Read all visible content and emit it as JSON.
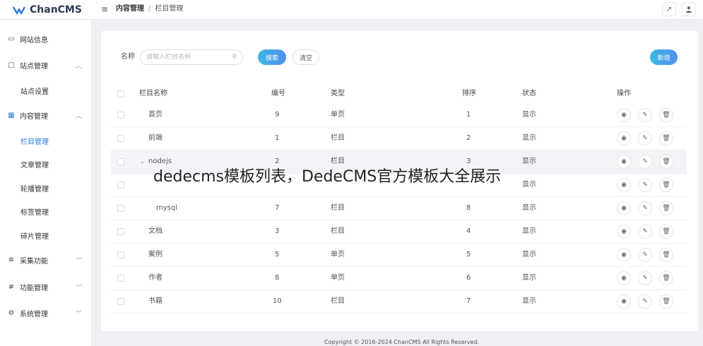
{
  "app": {
    "name": "ChanCMS"
  },
  "header": {
    "breadcrumb": [
      "内容管理",
      "栏目管理"
    ],
    "menu_icon": "menu-icon",
    "external_icon": "external-link-icon",
    "user_icon": "user-icon"
  },
  "sidebar": {
    "items": [
      {
        "label": "网站信息",
        "icon": "message-icon"
      },
      {
        "label": "站点管理",
        "icon": "monitor-icon",
        "expanded": true
      },
      {
        "label": "站点设置"
      },
      {
        "label": "内容管理",
        "icon": "grid-icon",
        "expanded": true
      },
      {
        "label": "栏目管理",
        "active": true
      },
      {
        "label": "文章管理"
      },
      {
        "label": "轮播管理"
      },
      {
        "label": "标签管理"
      },
      {
        "label": "碎片管理"
      },
      {
        "label": "采集功能",
        "icon": "spider-icon"
      },
      {
        "label": "功能管理",
        "icon": "sliders-icon"
      },
      {
        "label": "系统管理",
        "icon": "gear-icon"
      }
    ]
  },
  "search": {
    "label": "名称",
    "placeholder": "请输入栏目名称",
    "search_button": "搜索",
    "clear_button": "清空",
    "add_button": "新增"
  },
  "table": {
    "headers": [
      "栏目名称",
      "编号",
      "类型",
      "排序",
      "状态",
      "操作"
    ],
    "rows": [
      {
        "name": "首页",
        "id": "9",
        "type": "单页",
        "order": "1",
        "status": "显示"
      },
      {
        "name": "前端",
        "id": "1",
        "type": "栏目",
        "order": "2",
        "status": "显示"
      },
      {
        "name": "nodejs",
        "id": "2",
        "type": "栏目",
        "order": "3",
        "status": "显示",
        "expandable": true
      },
      {
        "name": "",
        "id": "",
        "type": "",
        "order": "",
        "status": "显示"
      },
      {
        "name": "mysql",
        "id": "7",
        "type": "栏目",
        "order": "8",
        "status": "显示",
        "child": true
      },
      {
        "name": "文档",
        "id": "3",
        "type": "栏目",
        "order": "4",
        "status": "显示"
      },
      {
        "name": "案例",
        "id": "5",
        "type": "单页",
        "order": "5",
        "status": "显示"
      },
      {
        "name": "作者",
        "id": "8",
        "type": "单页",
        "order": "6",
        "status": "显示"
      },
      {
        "name": "书籍",
        "id": "10",
        "type": "栏目",
        "order": "7",
        "status": "显示"
      }
    ]
  },
  "overlay_text": "dedecms模板列表，DedeCMS官方模板大全展示",
  "footer": "Copyright © 2016-2024 ChanCMS All Rights Reserved."
}
